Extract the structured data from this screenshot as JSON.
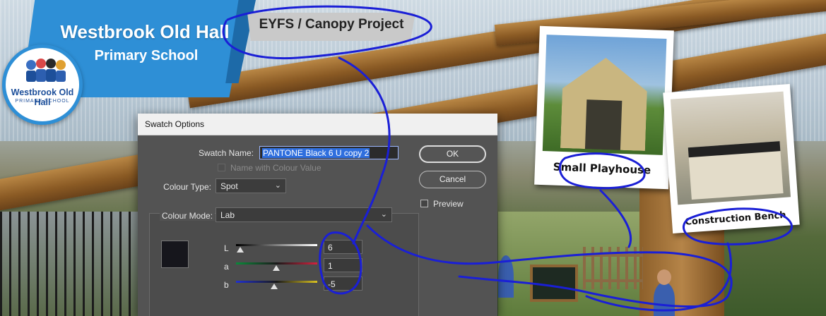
{
  "banner": {
    "school_name": "Westbrook Old Hall",
    "school_sub": "Primary School",
    "logo_name": "Westbrook Old Hall",
    "logo_sub": "PRIMARY SCHOOL",
    "project": "EYFS / Canopy Project"
  },
  "photos": [
    {
      "caption": "Small Playhouse"
    },
    {
      "caption": "Construction Bench"
    }
  ],
  "dialog": {
    "title": "Swatch Options",
    "swatch_name_label": "Swatch Name:",
    "swatch_name_value": "PANTONE Black 6 U copy 2",
    "name_with_colour_value_label": "Name with Colour Value",
    "colour_type_label": "Colour Type:",
    "colour_type_value": "Spot",
    "colour_mode_label": "Colour Mode:",
    "colour_mode_value": "Lab",
    "ok_label": "OK",
    "cancel_label": "Cancel",
    "preview_label": "Preview",
    "preview_checked": false,
    "name_with_colour_value_checked": false,
    "swatch_color": "#16161c",
    "channels": [
      {
        "label": "L",
        "value": "6"
      },
      {
        "label": "a",
        "value": "1"
      },
      {
        "label": "b",
        "value": "-5"
      }
    ]
  },
  "colors": {
    "banner_blue": "#2e8fd6",
    "annotation_ink": "#1a1fd6"
  }
}
